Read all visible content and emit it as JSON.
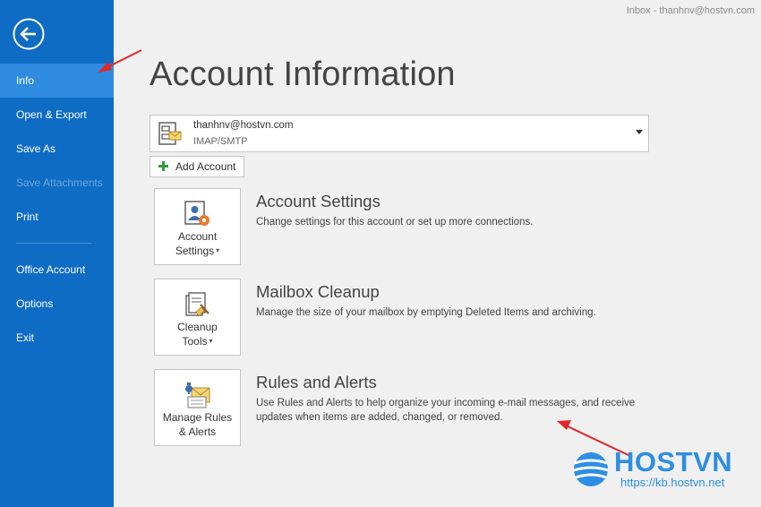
{
  "window": {
    "title": "Inbox - thanhnv@hostvn.com"
  },
  "sidebar": {
    "back_icon": "back-arrow-icon",
    "items": [
      {
        "label": "Info",
        "active": true,
        "disabled": false
      },
      {
        "label": "Open & Export",
        "active": false,
        "disabled": false
      },
      {
        "label": "Save As",
        "active": false,
        "disabled": false
      },
      {
        "label": "Save Attachments",
        "active": false,
        "disabled": true
      },
      {
        "label": "Print",
        "active": false,
        "disabled": false
      },
      {
        "label": "Office Account",
        "active": false,
        "disabled": false
      },
      {
        "label": "Options",
        "active": false,
        "disabled": false
      },
      {
        "label": "Exit",
        "active": false,
        "disabled": false
      }
    ]
  },
  "main": {
    "title": "Account Information",
    "account": {
      "email": "thanhnv@hostvn.com",
      "type": "IMAP/SMTP"
    },
    "add_account_label": "Add Account",
    "sections": [
      {
        "tile_line1": "Account",
        "tile_line2": "Settings",
        "tile_has_caret": true,
        "title": "Account Settings",
        "description": "Change settings for this account or set up more connections."
      },
      {
        "tile_line1": "Cleanup",
        "tile_line2": "Tools",
        "tile_has_caret": true,
        "title": "Mailbox Cleanup",
        "description": "Manage the size of your mailbox by emptying Deleted Items and archiving."
      },
      {
        "tile_line1": "Manage Rules",
        "tile_line2": "& Alerts",
        "tile_has_caret": false,
        "title": "Rules and Alerts",
        "description": "Use Rules and Alerts to help organize your incoming e-mail messages, and receive updates when items are added, changed, or removed."
      }
    ]
  },
  "watermark": {
    "brand": "HOSTVN",
    "url": "https://kb.hostvn.net"
  },
  "colors": {
    "sidebar": "#0f6cc4",
    "sidebar_active": "#2f8be0",
    "annotation_arrow": "#e0272a",
    "watermark": "#2d8ee3"
  }
}
